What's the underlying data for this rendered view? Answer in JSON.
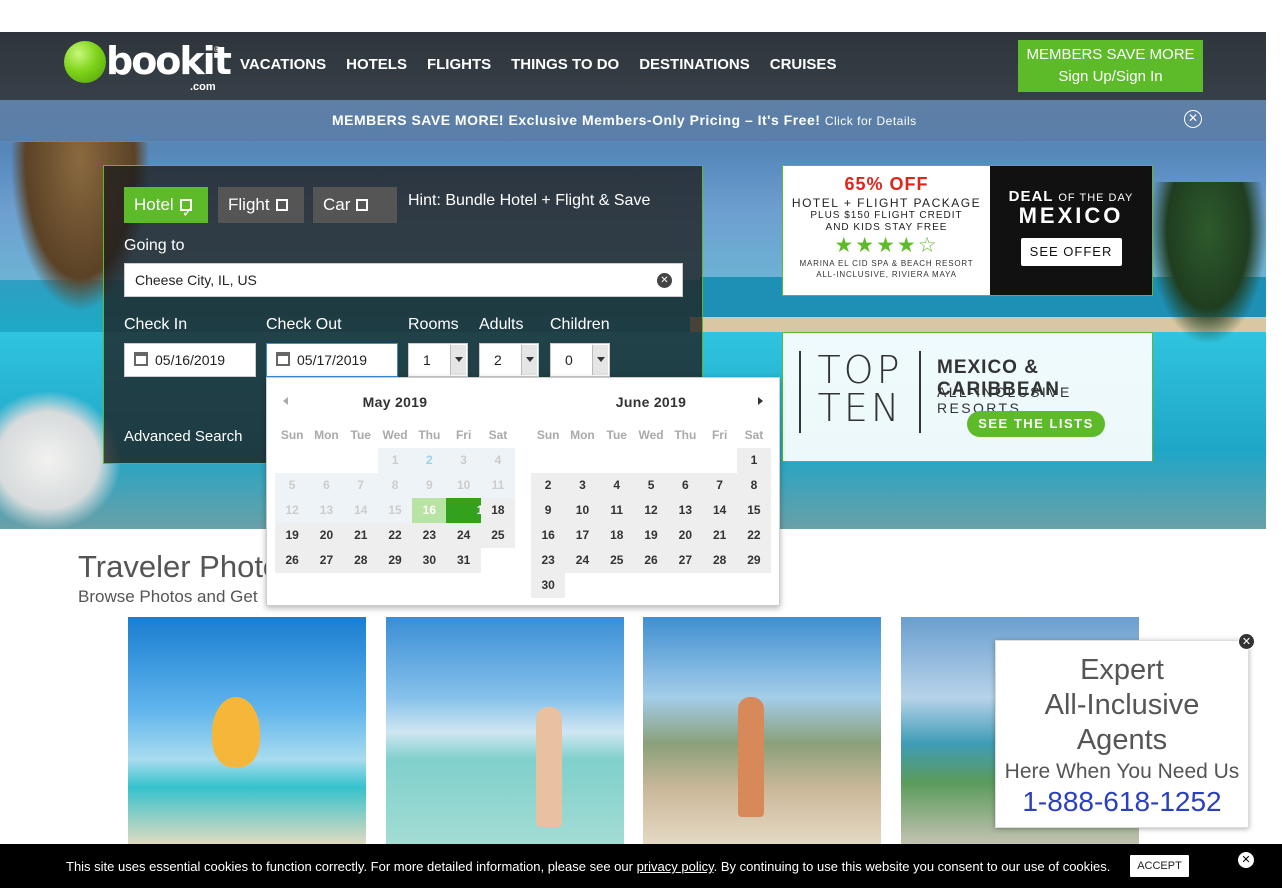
{
  "logo": {
    "word": "bookit",
    "com": ".com",
    "reg": "®"
  },
  "nav": [
    "VACATIONS",
    "HOTELS",
    "FLIGHTS",
    "THINGS TO DO",
    "DESTINATIONS",
    "CRUISES"
  ],
  "members_button": {
    "line1": "MEMBERS SAVE MORE",
    "line2": "Sign Up/Sign In"
  },
  "promo": {
    "bold": "MEMBERS SAVE MORE! Exclusive Members-Only Pricing – It's Free!",
    "small": "Click for Details",
    "close_icon": "close-circle-icon"
  },
  "search": {
    "tabs": [
      {
        "label": "Hotel",
        "checked": true
      },
      {
        "label": "Flight",
        "checked": false
      },
      {
        "label": "Car",
        "checked": false
      }
    ],
    "hint": "Hint: Bundle Hotel + Flight & Save",
    "going_label": "Going to",
    "going_value": "Cheese City, IL, US",
    "checkin_label": "Check In",
    "checkin_value": "05/16/2019",
    "checkout_label": "Check Out",
    "checkout_value": "05/17/2019",
    "rooms_label": "Rooms",
    "rooms_value": "1",
    "adults_label": "Adults",
    "adults_value": "2",
    "children_label": "Children",
    "children_value": "0",
    "advanced": "Advanced Search"
  },
  "datepicker": {
    "weekdays": [
      "Sun",
      "Mon",
      "Tue",
      "Wed",
      "Thu",
      "Fri",
      "Sat"
    ],
    "months": [
      {
        "title": "May 2019",
        "lead_empty": 3,
        "days": 31,
        "disabled_until": 15,
        "range_start": 16,
        "selected": 17
      },
      {
        "title": "June 2019",
        "lead_empty": 6,
        "days": 30
      }
    ]
  },
  "ad_deal": {
    "percent": "65% OFF",
    "package": "HOTEL + FLIGHT PACKAGE",
    "sub1": "PLUS $150 FLIGHT CREDIT",
    "sub2": "AND KIDS STAY FREE",
    "stars": "★★★★☆",
    "resort1": "MARINA EL CID SPA & BEACH RESORT",
    "resort2": "ALL-INCLUSIVE, RIVIERA MAYA",
    "deal_big": "DEAL",
    "deal_small": "OF THE DAY",
    "destination": "MEXICO",
    "button": "SEE OFFER"
  },
  "ad_top": {
    "top": "TOP",
    "ten": "TEN",
    "title": "MEXICO & CARIBBEAN",
    "subtitle": "ALL-INCLUSIVE RESORTS",
    "button": "SEE THE LISTS"
  },
  "traveler": {
    "title": "Traveler Photo",
    "subtitle": "Browse Photos and Get"
  },
  "agent": {
    "line1": "Expert",
    "line2": "All-Inclusive",
    "line3": "Agents",
    "line4": "Here When You Need Us",
    "phone": "1-888-618-1252"
  },
  "cookie": {
    "before": "This site uses essential cookies to function correctly. For more detailed information, please see our ",
    "link": "privacy policy",
    "after": ". By continuing to use this website you consent to our use of cookies.",
    "accept": "ACCEPT"
  },
  "colors": {
    "brand_green": "#5dbb2a",
    "selected_day": "#33a11d",
    "phone_blue": "#2a3fc1"
  }
}
